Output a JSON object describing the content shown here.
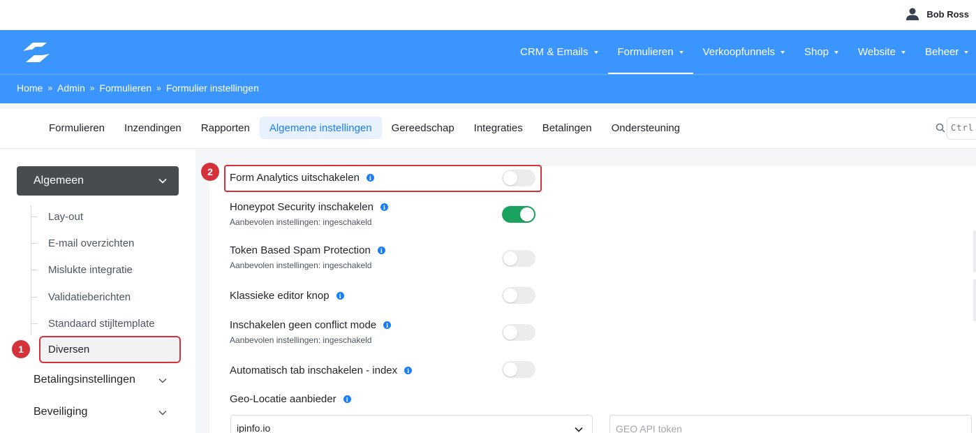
{
  "user": {
    "name": "Bob Ross",
    "icon": "user-icon"
  },
  "nav": {
    "items": [
      {
        "label": "CRM & Emails"
      },
      {
        "label": "Formulieren",
        "active": true
      },
      {
        "label": "Verkoopfunnels"
      },
      {
        "label": "Shop"
      },
      {
        "label": "Website"
      },
      {
        "label": "Beheer"
      }
    ]
  },
  "breadcrumb": {
    "items": [
      "Home",
      "Admin",
      "Formulieren",
      "Formulier instellingen"
    ],
    "separator": "»"
  },
  "tabs": {
    "items": [
      "Formulieren",
      "Inzendingen",
      "Rapporten",
      "Algemene instellingen",
      "Gereedschap",
      "Integraties",
      "Betalingen",
      "Ondersteuning"
    ],
    "active": "Algemene instellingen"
  },
  "search": {
    "shortcut": "Ctrl"
  },
  "sidebar": {
    "group_title": "Algemeen",
    "items": [
      "Lay-out",
      "E-mail overzichten",
      "Mislukte integratie",
      "Validatieberichten",
      "Standaard stijltemplate",
      "Diversen"
    ],
    "selected": "Diversen",
    "groups": [
      "Betalingsinstellingen",
      "Beveiliging"
    ]
  },
  "annotations": {
    "badge_1": "1",
    "badge_2": "2"
  },
  "settings": [
    {
      "label": "Form Analytics uitschakelen",
      "enabled": false
    },
    {
      "label": "Honeypot Security inschakelen",
      "sub": "Aanbevolen instellingen: ingeschakeld",
      "enabled": true
    },
    {
      "label": "Token Based Spam Protection",
      "sub": "Aanbevolen instellingen: ingeschakeld",
      "enabled": false
    },
    {
      "label": "Klassieke editor knop",
      "enabled": false
    },
    {
      "label": "Inschakelen geen conflict mode",
      "sub": "Aanbevolen instellingen: ingeschakeld",
      "enabled": false
    },
    {
      "label": "Automatisch tab inschakelen - index",
      "enabled": false
    }
  ],
  "geo": {
    "label": "Geo-Locatie aanbieder",
    "provider": "ipinfo.io",
    "token_placeholder": "GEO API token"
  },
  "colors": {
    "primary": "#3a96fe",
    "accent": "#1a7efb",
    "toggle_on": "#1aa35f",
    "annotation": "#d5313a",
    "sidebar_head": "#484c50"
  }
}
